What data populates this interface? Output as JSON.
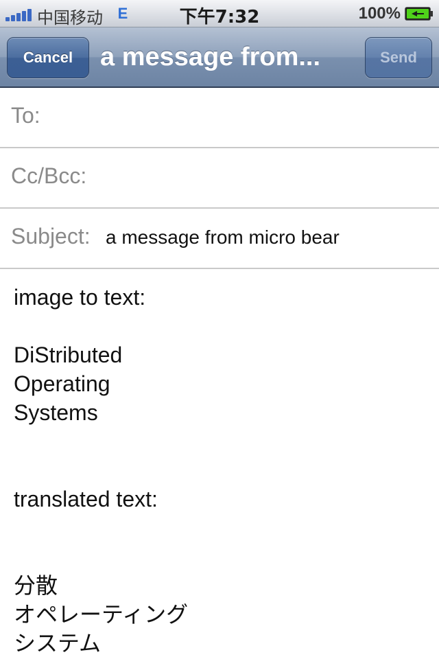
{
  "status_bar": {
    "carrier": "中国移动",
    "network": "E",
    "time": "下午7:32",
    "battery_percent": "100%",
    "signal_bars": 5,
    "battery_icon": "battery-charging-icon",
    "accent_color": "#3a68c4"
  },
  "nav": {
    "title": "a message from...",
    "cancel_label": "Cancel",
    "send_label": "Send"
  },
  "fields": {
    "to_label": "To:",
    "to_value": "",
    "cc_label": "Cc/Bcc:",
    "cc_value": "",
    "subject_label": "Subject:",
    "subject_value": "a message from micro bear"
  },
  "body": {
    "heading_image": "image to text:",
    "ocr_lines": [
      "DiStributed",
      "Operating",
      "Systems"
    ],
    "heading_translated": "translated text:",
    "translated_lines": [
      "分散",
      "オペレーティング",
      "システム"
    ]
  }
}
